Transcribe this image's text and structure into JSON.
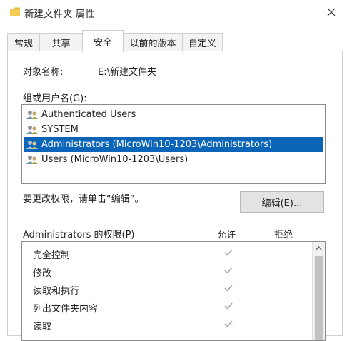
{
  "window": {
    "title": "新建文件夹 属性",
    "close_icon": "close-icon",
    "folder_icon": "folder-icon",
    "folder_color": "#e8b93a"
  },
  "tabs": [
    {
      "label": "常规"
    },
    {
      "label": "共享"
    },
    {
      "label": "安全",
      "active": true
    },
    {
      "label": "以前的版本"
    },
    {
      "label": "自定义"
    }
  ],
  "security": {
    "object_name_label": "对象名称:",
    "object_name_value": "E:\\新建文件夹",
    "groups_label": "组或用户名(G):",
    "users": [
      {
        "name": "Authenticated Users"
      },
      {
        "name": "SYSTEM"
      },
      {
        "name": "Administrators (MicroWin10-1203\\Administrators)",
        "selected": true
      },
      {
        "name": "Users (MicroWin10-1203\\Users)"
      }
    ],
    "hint": "要更改权限，请单击“编辑”。",
    "edit_button": "编辑(E)...",
    "permissions_header": "Administrators 的权限(P)",
    "allow_header": "允许",
    "deny_header": "拒绝",
    "permissions": [
      {
        "name": "完全控制",
        "allow": true
      },
      {
        "name": "修改",
        "allow": true
      },
      {
        "name": "读取和执行",
        "allow": true
      },
      {
        "name": "列出文件夹内容",
        "allow": true
      },
      {
        "name": "读取",
        "allow": true
      }
    ],
    "selection_color": "#0a64b8",
    "check_color": "#a6a6a6"
  }
}
